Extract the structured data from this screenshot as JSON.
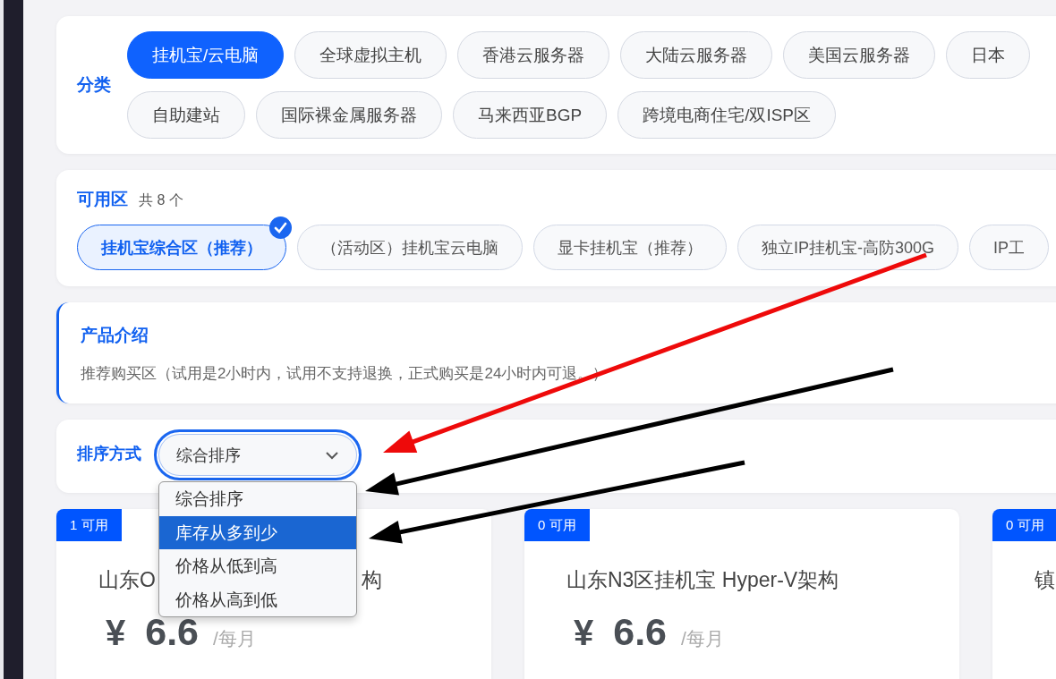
{
  "category": {
    "label": "分类",
    "rows": [
      [
        {
          "label": "挂机宝/云电脑",
          "selected": true
        },
        {
          "label": "全球虚拟主机",
          "selected": false
        },
        {
          "label": "香港云服务器",
          "selected": false
        },
        {
          "label": "大陆云服务器",
          "selected": false
        },
        {
          "label": "美国云服务器",
          "selected": false
        },
        {
          "label": "日本",
          "selected": false
        }
      ],
      [
        {
          "label": "自助建站",
          "selected": false
        },
        {
          "label": "国际裸金属服务器",
          "selected": false
        },
        {
          "label": "马来西亚BGP",
          "selected": false
        },
        {
          "label": "跨境电商住宅/双ISP区",
          "selected": false
        }
      ]
    ]
  },
  "zones": {
    "title": "可用区",
    "count": "共 8 个",
    "items": [
      {
        "label": "挂机宝综合区（推荐）",
        "selected": true
      },
      {
        "label": "（活动区）挂机宝云电脑",
        "selected": false
      },
      {
        "label": "显卡挂机宝（推荐）",
        "selected": false
      },
      {
        "label": "独立IP挂机宝-高防300G",
        "selected": false
      },
      {
        "label": "IP工",
        "selected": false
      }
    ]
  },
  "intro": {
    "title": "产品介绍",
    "text": "推荐购买区（试用是2小时内，试用不支持退换，正式购买是24小时内可退。）"
  },
  "sort": {
    "label": "排序方式",
    "value": "综合排序",
    "expanded": true,
    "options": [
      {
        "label": "综合排序",
        "highlighted": false
      },
      {
        "label": "库存从多到少",
        "highlighted": true
      },
      {
        "label": "价格从低到高",
        "highlighted": false
      },
      {
        "label": "价格从高到低",
        "highlighted": false
      }
    ]
  },
  "products": [
    {
      "badge": "1 可用",
      "title_parts": [
        "山东O",
        "构"
      ],
      "currency": "¥",
      "price": "6.6",
      "period": "/每月"
    },
    {
      "badge": "0 可用",
      "title_parts": [
        "山东N3区挂机宝 Hyper-V架构"
      ],
      "currency": "¥",
      "price": "6.6",
      "period": "/每月"
    },
    {
      "badge": "0 可用",
      "title_parts": [
        "镇"
      ]
    }
  ],
  "arrows": [
    {
      "color": "#ee0a0a"
    },
    {
      "color": "#000000"
    },
    {
      "color": "#000000"
    }
  ]
}
